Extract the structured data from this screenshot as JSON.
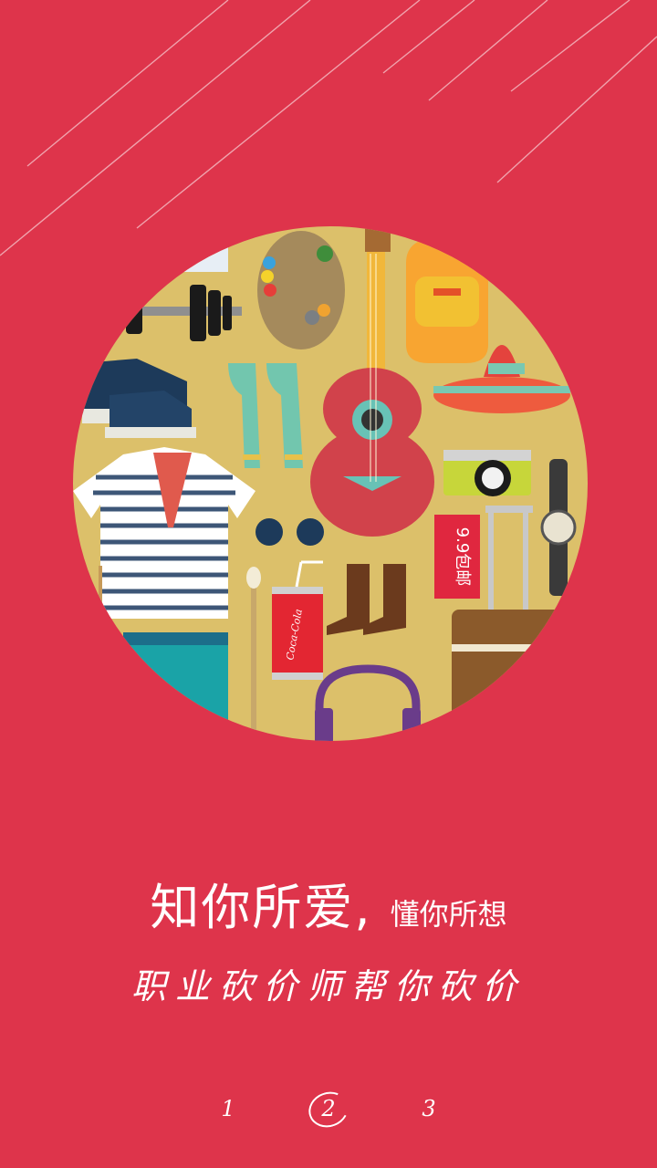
{
  "headline": {
    "main": "知你所爱,",
    "sub": "懂你所想"
  },
  "tagline": "职业砍价师帮你砍价",
  "illustration": {
    "price_tag": "9.9包邮",
    "can_brand": "Coca-Cola"
  },
  "pager": {
    "pages": [
      "1",
      "2",
      "3"
    ],
    "active_index": 1
  },
  "colors": {
    "background": "#de344b",
    "circle": "#dcc06a",
    "text": "#ffffff"
  }
}
